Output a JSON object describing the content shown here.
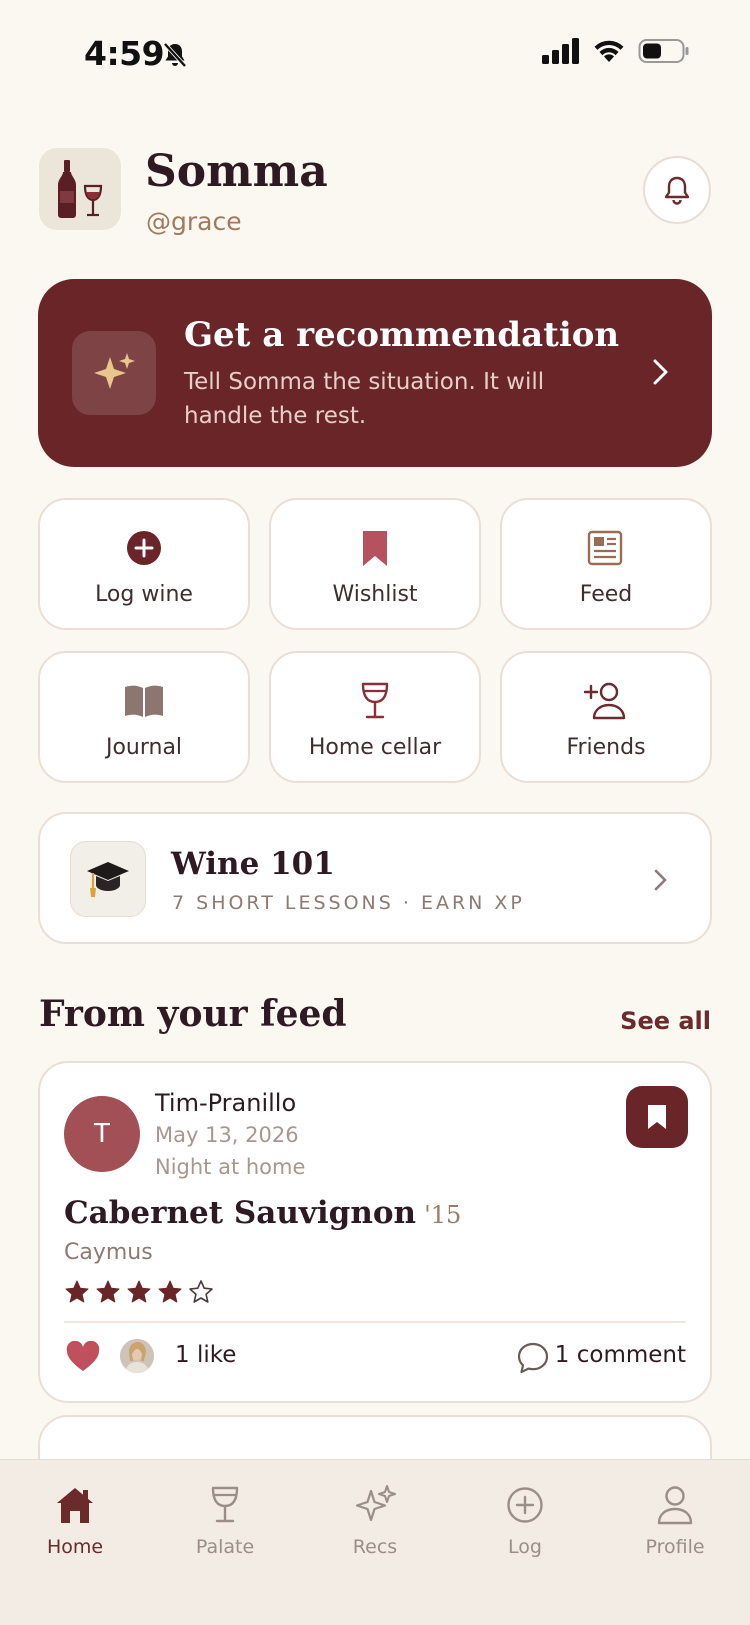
{
  "status_bar": {
    "time": "4:59"
  },
  "header": {
    "title": "Somma",
    "handle": "@grace"
  },
  "recommendation": {
    "title": "Get a recommendation",
    "subtitle": "Tell Somma the situation. It will handle the rest."
  },
  "tiles": [
    {
      "label": "Log wine",
      "icon": "plus-circle-icon"
    },
    {
      "label": "Wishlist",
      "icon": "bookmark-icon"
    },
    {
      "label": "Feed",
      "icon": "newspaper-icon"
    },
    {
      "label": "Journal",
      "icon": "book-icon"
    },
    {
      "label": "Home cellar",
      "icon": "wine-glass-icon"
    },
    {
      "label": "Friends",
      "icon": "add-friend-icon"
    }
  ],
  "course": {
    "title": "Wine 101",
    "subtitle": "7 SHORT LESSONS · EARN XP"
  },
  "feed": {
    "title": "From your feed",
    "see_all": "See all",
    "post": {
      "avatar_initial": "T",
      "user": "Tim-Pranillo",
      "date": "May 13, 2026",
      "occasion": "Night at home",
      "wine": "Cabernet Sauvignon",
      "vintage": "'15",
      "producer": "Caymus",
      "rating": 4,
      "rating_max": 5,
      "likes": "1 like",
      "comments": "1 comment"
    }
  },
  "tab_bar": {
    "items": [
      {
        "label": "Home",
        "icon": "home-icon",
        "active": true
      },
      {
        "label": "Palate",
        "icon": "wine-glass-icon",
        "active": false
      },
      {
        "label": "Recs",
        "icon": "sparkles-icon",
        "active": false
      },
      {
        "label": "Log",
        "icon": "plus-circle-icon",
        "active": false
      },
      {
        "label": "Profile",
        "icon": "person-icon",
        "active": false
      }
    ]
  },
  "colors": {
    "background": "#FBF7F1",
    "accent": "#692527",
    "accent_text": "#6B2A2C",
    "avatar": "#A24F55",
    "heart": "#C0505E"
  }
}
